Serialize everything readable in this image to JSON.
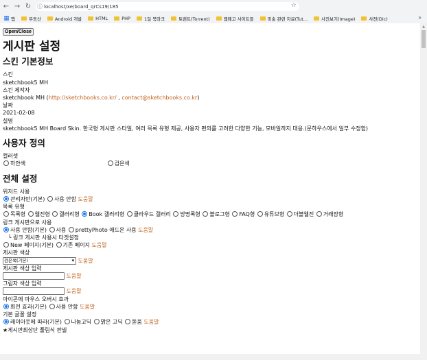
{
  "browser": {
    "url": "localhost/xe/board_qrCs19/185",
    "bookmarks": [
      "앱",
      "부동산",
      "Android 개발",
      "HTML",
      "PHP",
      "1일 북마크",
      "토렌트(Torrent)",
      "웹페고 사이트들",
      "미술 관련 자료(Tut...",
      "사진보기(Image)",
      "사전(Dic)"
    ],
    "more": "»"
  },
  "page": {
    "toggle_button": "Open/Close",
    "title": "게시판 설정",
    "skin_info": {
      "heading": "스킨 기본정보",
      "skin_label": "스킨",
      "skin_value": "sketchbook5 MH",
      "maker_label": "스킨 제작자",
      "maker_name": "sketchbook MH (",
      "maker_link": "http://sketchbooks.co.kr/",
      "maker_sep": " , ",
      "maker_email": "contact@sketchbooks.co.kr",
      "maker_close": ")",
      "date_label": "날짜",
      "date_value": "2021-02-08",
      "desc_label": "설명",
      "desc_value": "sketchbook5 MH Board Skin. 한국형 게시판 스타일, 여러 목록 유형 제공, 사용자 편의를 고려한 다양한 기능, 모바일까지 대응.(문하우스에서 일부 수정함)"
    },
    "user_def": {
      "heading": "사용자 정의",
      "color_label": "컬러셋",
      "color_opt1": "하얀색",
      "color_opt2": "검은색"
    },
    "all_settings": {
      "heading": "전체 설정",
      "help": "도움말",
      "wizard_label": "위저드 사용",
      "wizard_opt1": "관리자만(기본)",
      "wizard_opt2": "사용 안함",
      "list_label": "목록 유형",
      "list_opts": [
        "목록형",
        "웹진형",
        "갤러리형",
        "Book 갤러리형",
        "클라우드 갤러리",
        "방명록형",
        "블로그형",
        "FAQ형",
        "유튜브형",
        "더블웹진",
        "거래장형"
      ],
      "link_label": "링크 게시판으로 사용",
      "link_opt1": "사용 안함(기본)",
      "link_opt2": "사용",
      "link_opt3": "prettyPhoto 애드온 사용",
      "link_target_label": "└ 링크 게시판 사용시 타겟설정",
      "link_target_opt1": "New 페이지(기본)",
      "link_target_opt2": "기존 페이지",
      "color_label": "게시판 색상",
      "color_select": "검은색(기본)",
      "color_input_label": "게시판 색상 입력",
      "shadow_label": "그림자 색상 입력",
      "hover_label": "아이콘에 마우스 오버시 효과",
      "hover_opt1": "회전 효과(기본)",
      "hover_opt2": "사용 안함",
      "font_label": "기본 글꼴 설정",
      "font_opts": [
        "레이아웃에 따라(기본)",
        "나눔고딕",
        "맑은 고딕",
        "돋움"
      ],
      "panel_label": "★게시판최상단 풀림식 판넬"
    }
  }
}
